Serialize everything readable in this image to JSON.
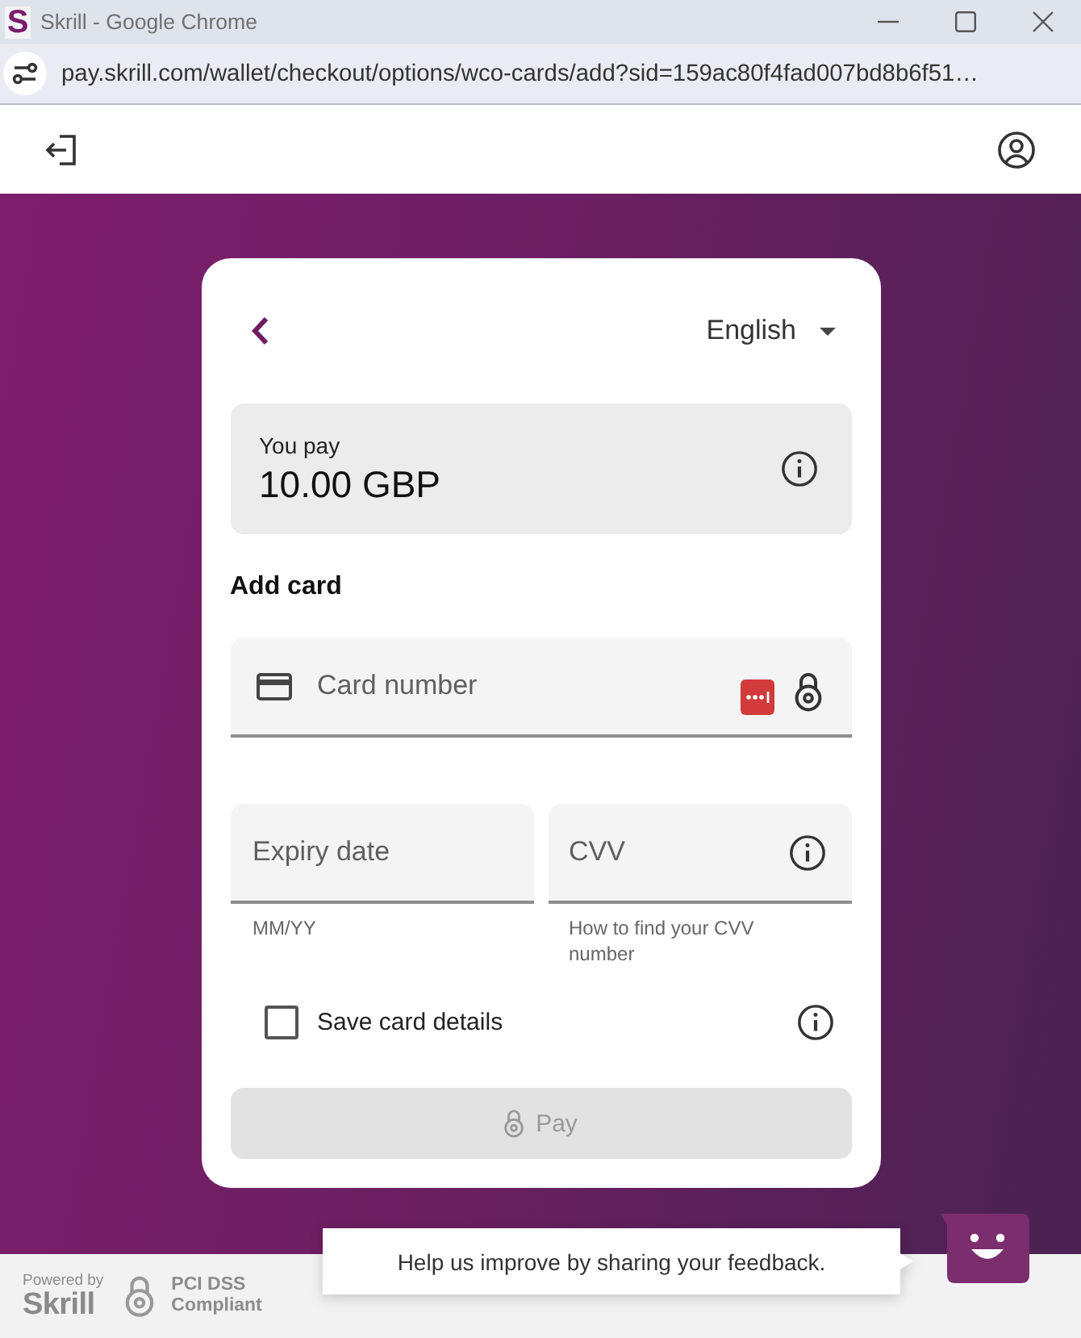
{
  "window": {
    "icon_text": "S",
    "title": "Skrill - Google Chrome"
  },
  "address_bar": {
    "url": "pay.skrill.com/wallet/checkout/options/wco-cards/add?sid=159ac80f4fad007bd8b6f51…"
  },
  "checkout": {
    "language": "English",
    "amount": {
      "label": "You pay",
      "value": "10.00 GBP"
    },
    "section_title": "Add card",
    "card_number": {
      "placeholder": "Card number"
    },
    "expiry": {
      "placeholder": "Expiry date",
      "helper": "MM/YY"
    },
    "cvv": {
      "placeholder": "CVV",
      "helper": "How to find your CVV number"
    },
    "save_card": {
      "label": "Save card details",
      "checked": false
    },
    "pay_button": {
      "label": "Pay",
      "disabled": true
    }
  },
  "footer": {
    "powered_by": "Powered by",
    "brand": "Skrill",
    "certification": "PCI DSS Compliant"
  },
  "feedback": {
    "message": "Help us improve by sharing your feedback."
  }
}
